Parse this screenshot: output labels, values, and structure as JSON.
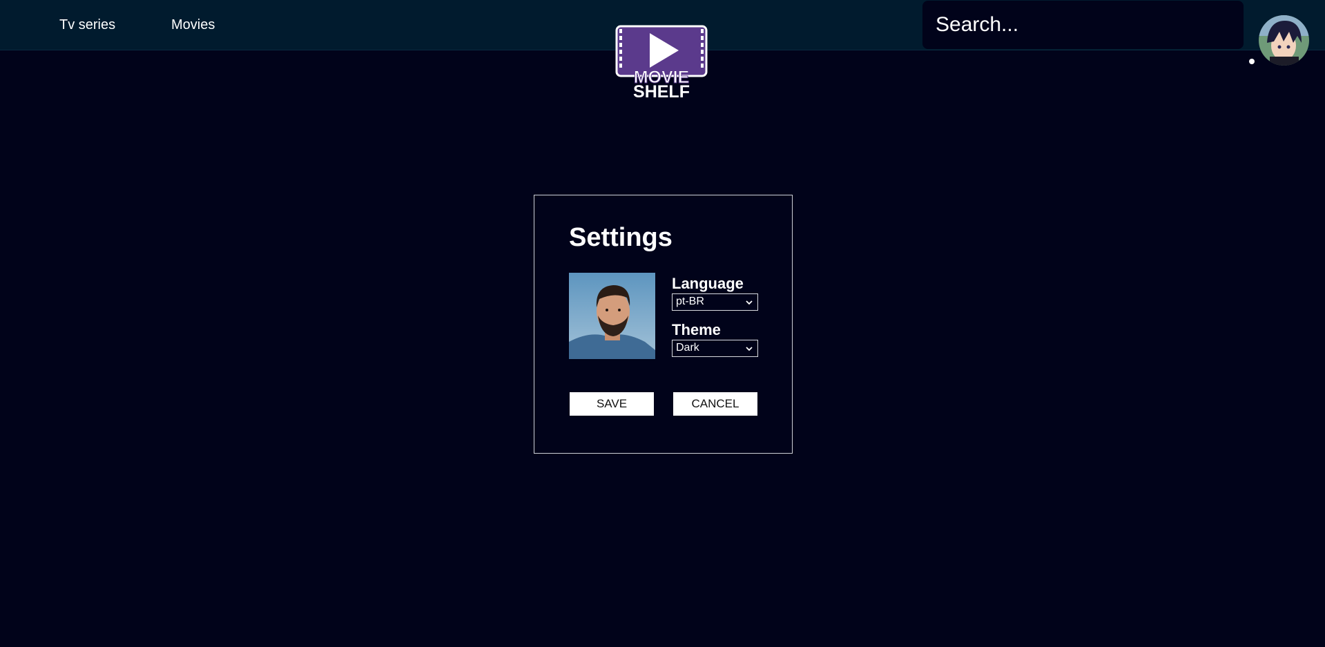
{
  "nav": {
    "tv_series": "Tv series",
    "movies": "Movies"
  },
  "logo": {
    "line1": "MOVIE",
    "line2": "SHELF",
    "color": "#5b3a8c"
  },
  "search": {
    "placeholder": "Search..."
  },
  "settings": {
    "title": "Settings",
    "language_label": "Language",
    "language_value": "pt-BR",
    "theme_label": "Theme",
    "theme_value": "Dark",
    "save_label": "SAVE",
    "cancel_label": "CANCEL"
  },
  "colors": {
    "background": "#01031a",
    "topbar": "#011b2e",
    "accent_logo": "#5b3a8c"
  }
}
